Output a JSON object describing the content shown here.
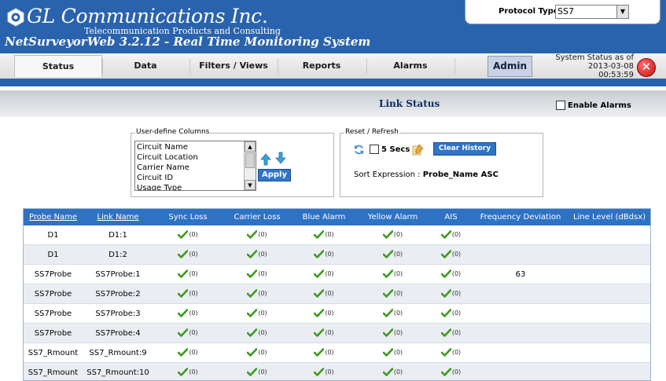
{
  "header": {
    "company": "GL Communications Inc.",
    "tagline": "Telecommunication Products and Consulting",
    "product": "NetSurveyorWeb 3.2.12 - Real Time Monitoring System",
    "protocol_label": "Protocol Type",
    "protocol_value": "SS7"
  },
  "nav": {
    "tabs": [
      {
        "label": "Status"
      },
      {
        "label": "Data"
      },
      {
        "label": "Filters / Views"
      },
      {
        "label": "Reports"
      },
      {
        "label": "Alarms"
      }
    ],
    "admin": "Admin",
    "system_status_label": "System Status as of",
    "system_status_date": "2013-03-08",
    "system_status_time": "00:53:59"
  },
  "page": {
    "title": "Link Status",
    "enable_alarms": "Enable Alarms"
  },
  "columns_panel": {
    "legend": "User-define Columns",
    "items": [
      "Circuit Name",
      "Circuit Location",
      "Carrier Name",
      "Circuit ID",
      "Usage Type"
    ],
    "apply": "Apply"
  },
  "refresh_panel": {
    "legend": "Reset / Refresh",
    "secs": "5 Secs",
    "clear_history": "Clear History",
    "sort_label": "Sort Expression :",
    "sort_value": "Probe_Name ASC"
  },
  "table": {
    "headers": [
      "Probe Name",
      "Link Name",
      "Sync Loss",
      "Carrier Loss",
      "Blue Alarm",
      "Yellow Alarm",
      "AIS",
      "Frequency Deviation",
      "Line Level (dBdsx)"
    ],
    "rows": [
      {
        "probe": "D1",
        "link": "D1:1",
        "sync": "(0)",
        "carrier": "(0)",
        "blue": "(0)",
        "yellow": "(0)",
        "ais": "(0)",
        "freq": "",
        "level": ""
      },
      {
        "probe": "D1",
        "link": "D1:2",
        "sync": "(0)",
        "carrier": "(0)",
        "blue": "(0)",
        "yellow": "(0)",
        "ais": "(0)",
        "freq": "",
        "level": ""
      },
      {
        "probe": "SS7Probe",
        "link": "SS7Probe:1",
        "sync": "(0)",
        "carrier": "(0)",
        "blue": "(0)",
        "yellow": "(0)",
        "ais": "(0)",
        "freq": "63",
        "level": ""
      },
      {
        "probe": "SS7Probe",
        "link": "SS7Probe:2",
        "sync": "(0)",
        "carrier": "(0)",
        "blue": "(0)",
        "yellow": "(0)",
        "ais": "(0)",
        "freq": "",
        "level": ""
      },
      {
        "probe": "SS7Probe",
        "link": "SS7Probe:3",
        "sync": "(0)",
        "carrier": "(0)",
        "blue": "(0)",
        "yellow": "(0)",
        "ais": "(0)",
        "freq": "",
        "level": ""
      },
      {
        "probe": "SS7Probe",
        "link": "SS7Probe:4",
        "sync": "(0)",
        "carrier": "(0)",
        "blue": "(0)",
        "yellow": "(0)",
        "ais": "(0)",
        "freq": "",
        "level": ""
      },
      {
        "probe": "SS7_Rmount",
        "link": "SS7_Rmount:9",
        "sync": "(0)",
        "carrier": "(0)",
        "blue": "(0)",
        "yellow": "(0)",
        "ais": "(0)",
        "freq": "",
        "level": ""
      },
      {
        "probe": "SS7_Rmount",
        "link": "SS7_Rmount:10",
        "sync": "(0)",
        "carrier": "(0)",
        "blue": "(0)",
        "yellow": "(0)",
        "ais": "(0)",
        "freq": "",
        "level": ""
      }
    ]
  },
  "colors": {
    "header_blue": "#2a63ad",
    "table_header": "#2e72c4",
    "title_text": "#0d2d68",
    "check_green": "#3c9a1c"
  }
}
